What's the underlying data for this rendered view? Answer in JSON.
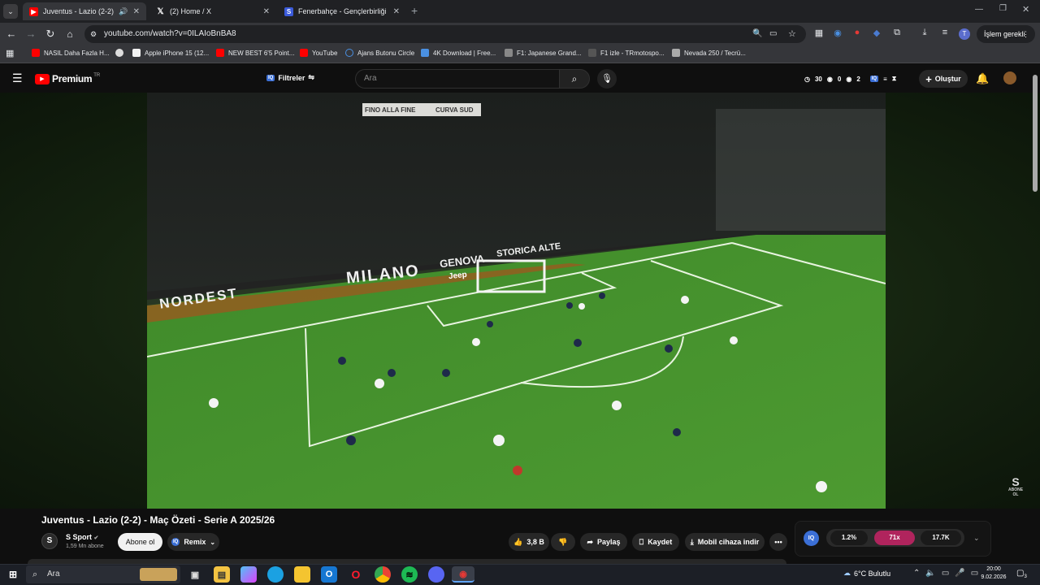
{
  "browser": {
    "tabs": [
      {
        "title": "Juventus - Lazio (2-2) - Maç",
        "active": true
      },
      {
        "title": "(2) Home / X",
        "active": false
      },
      {
        "title": "Fenerbahçe - Gençlerbirliği can",
        "active": false
      }
    ],
    "new_tab": "+",
    "url": "youtube.com/watch?v=0ILAIoBnBA8",
    "action_required": "İşlem gerekli",
    "profile_initial": "T"
  },
  "bookmarks": [
    {
      "label": "NASIL Daha Fazla H...",
      "color": "#ff0000"
    },
    {
      "label": "Apple iPhone 15 (12...",
      "color": "#f2f2f2"
    },
    {
      "label": "NEW BEST 6'5 Point...",
      "color": "#ff0000"
    },
    {
      "label": "YouTube",
      "color": "#ff0000"
    },
    {
      "label": "Ajans Butonu Circle",
      "color": "#4a90e2"
    },
    {
      "label": "4K Download | Free...",
      "color": "#4a90e2"
    },
    {
      "label": "F1: Japanese Grand...",
      "color": "#888888"
    },
    {
      "label": "F1 izle - TRmotospo...",
      "color": "#555555"
    },
    {
      "label": "Nevada 250 / Tecrü...",
      "color": "#aaaaaa"
    }
  ],
  "youtube": {
    "logo": "Premium",
    "region": "TR",
    "filters_label": "Filtreler",
    "search_placeholder": "Ara",
    "stat_a": "30",
    "stat_b": "0",
    "stat_c": "2",
    "create_label": "Oluştur"
  },
  "video": {
    "stadium_banner_1": "FINO ALLA FINE",
    "stadium_banner_2": "CURVA SUD",
    "stand_text_1": "MILANO",
    "stand_text_2": "GENOVA",
    "stand_text_3": "STORICA ALTE",
    "stand_text_4": "NORDEST",
    "sponsor": "Jeep",
    "watermark": "ABONE OL"
  },
  "details": {
    "title": "Juventus - Lazio (2-2) - Maç Özeti - Serie A 2025/26",
    "channel": "S Sport",
    "subscribers": "1,59 Mn abone",
    "subscribe_label": "Abone ol",
    "remix_label": "Remix",
    "likes": "3,8 B",
    "share_label": "Paylaş",
    "save_label": "Kaydet",
    "download_label": "Mobil cihaza indir",
    "stat_pct": "1.2%",
    "stat_ratio": "71x",
    "stat_views": "17.7K"
  },
  "taskbar": {
    "search_placeholder": "Ara",
    "weather": "6°C  Bulutlu",
    "time": "20:00",
    "date": "9.02.2026",
    "notification_count": "3"
  }
}
